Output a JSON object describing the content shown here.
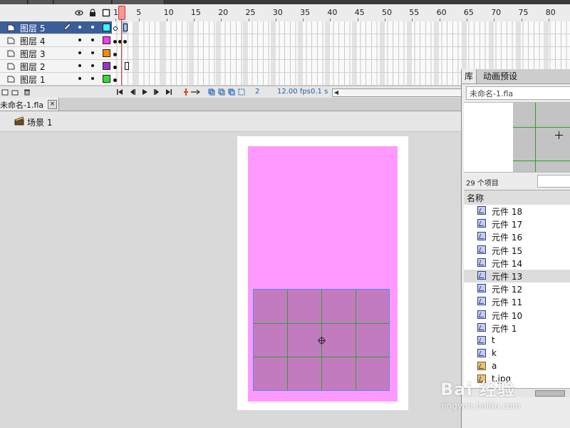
{
  "timeline": {
    "frame_numbers": [
      "1",
      "5",
      "10",
      "15",
      "20",
      "25",
      "30",
      "35",
      "40",
      "45",
      "50",
      "55",
      "60",
      "65",
      "70",
      "75",
      "80"
    ],
    "layers": [
      {
        "name": "图层 5",
        "color": "#33ffff",
        "selected": true
      },
      {
        "name": "图层 4",
        "color": "#ff33ff",
        "selected": false
      },
      {
        "name": "图层 3",
        "color": "#ff8800",
        "selected": false
      },
      {
        "name": "图层 2",
        "color": "#9933cc",
        "selected": false
      },
      {
        "name": "图层 1",
        "color": "#33dd33",
        "selected": false
      }
    ],
    "current_frame": "2",
    "fps": "12.00 fps",
    "elapsed": "0.1 s"
  },
  "document": {
    "tab_label": "未命名-1.fla",
    "close_label": "×",
    "scene_label": "场景 1"
  },
  "stage": {
    "background_color": "#ff99ff",
    "symbol_fill": "#c37bbf",
    "grid_line_color": "#2ea02e"
  },
  "library": {
    "tab_library": "库",
    "tab_motion_presets": "动画预设",
    "document_select": "未命名-1.fla",
    "item_count": "29 个项目",
    "column_name": "名称",
    "items": [
      {
        "label": "元件 18",
        "type": "symbol"
      },
      {
        "label": "元件 17",
        "type": "symbol"
      },
      {
        "label": "元件 16",
        "type": "symbol"
      },
      {
        "label": "元件 15",
        "type": "symbol"
      },
      {
        "label": "元件 14",
        "type": "symbol"
      },
      {
        "label": "元件 13",
        "type": "symbol"
      },
      {
        "label": "元件 12",
        "type": "symbol"
      },
      {
        "label": "元件 11",
        "type": "symbol"
      },
      {
        "label": "元件 10",
        "type": "symbol"
      },
      {
        "label": "元件 1",
        "type": "symbol"
      },
      {
        "label": "t",
        "type": "symbol"
      },
      {
        "label": "k",
        "type": "symbol"
      },
      {
        "label": "a",
        "type": "bitmap"
      },
      {
        "label": "t.jpg",
        "type": "bitmap"
      }
    ]
  },
  "watermark": {
    "logo": "Bai 经验",
    "url": "jingyan.baidu.com"
  }
}
